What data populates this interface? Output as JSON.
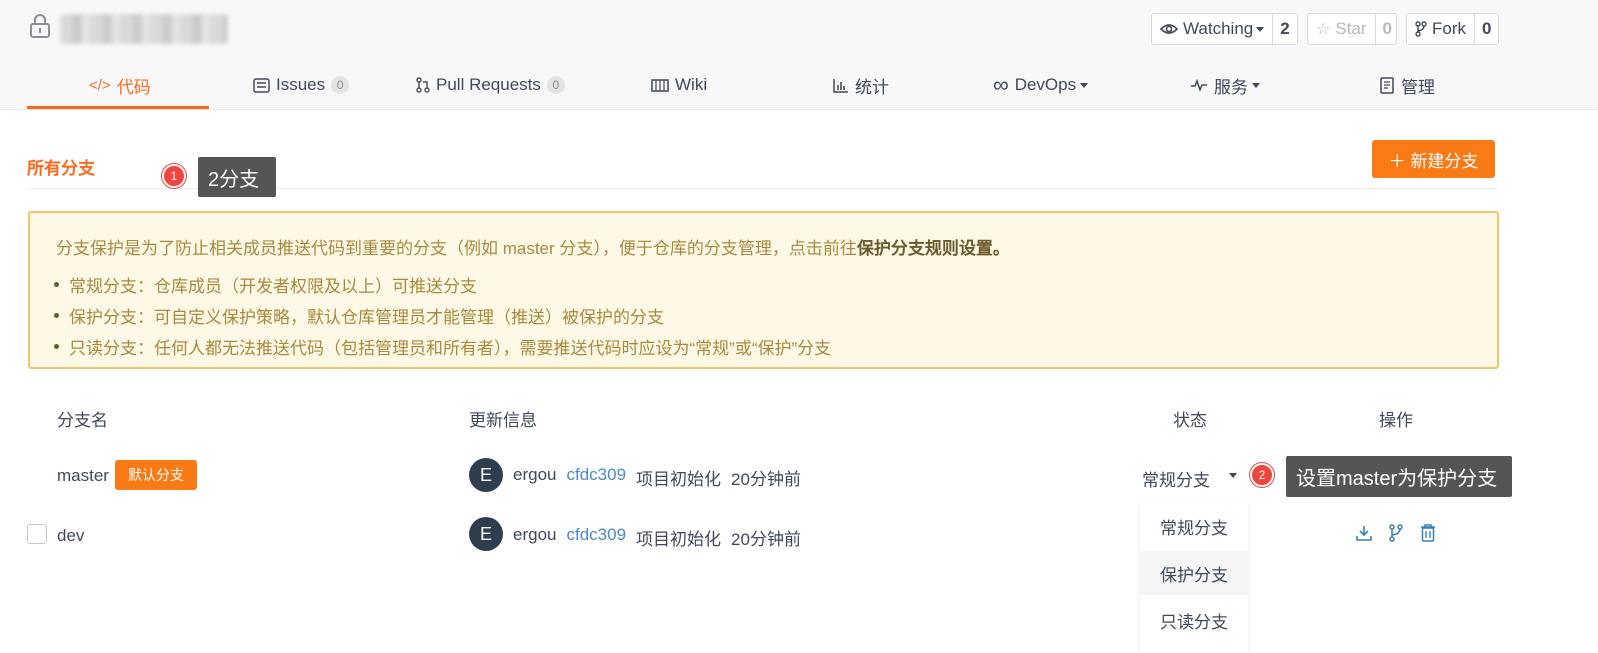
{
  "header": {
    "watch": {
      "label": "Watching",
      "count": "2",
      "icon": "eye-icon"
    },
    "star": {
      "label": "Star",
      "count": "0",
      "icon": "star-icon"
    },
    "fork": {
      "label": "Fork",
      "count": "0",
      "icon": "fork-icon"
    }
  },
  "nav": {
    "items": [
      {
        "label": "代码",
        "icon": "code-icon",
        "active": true
      },
      {
        "label": "Issues",
        "icon": "issues-icon",
        "badge": "0"
      },
      {
        "label": "Pull Requests",
        "icon": "pull-request-icon",
        "badge": "0"
      },
      {
        "label": "Wiki",
        "icon": "wiki-icon"
      },
      {
        "label": "统计",
        "icon": "chart-icon"
      },
      {
        "label": "DevOps",
        "icon": "infinity-icon"
      },
      {
        "label": "服务",
        "icon": "pulse-icon"
      },
      {
        "label": "管理",
        "icon": "manage-icon"
      }
    ]
  },
  "section": {
    "title": "所有分支",
    "new_branch": "＋ 新建分支"
  },
  "markers": [
    {
      "num": "1",
      "tooltip": "2分支"
    },
    {
      "num": "2",
      "tooltip": "设置master为保护分支"
    }
  ],
  "notice": {
    "head_text": "分支保护是为了防止相关成员推送代码到重要的分支（例如 master 分支），便于仓库的分支管理，点击前往",
    "head_link": "保护分支规则设置。",
    "items": [
      "常规分支：仓库成员（开发者权限及以上）可推送分支",
      "保护分支：可自定义保护策略，默认仓库管理员才能管理（推送）被保护的分支",
      "只读分支：任何人都无法推送代码（包括管理员和所有者），需要推送代码时应设为“常规”或“保护”分支"
    ]
  },
  "table": {
    "headers": {
      "name": "分支名",
      "update": "更新信息",
      "status": "状态",
      "actions": "操作"
    },
    "rows": [
      {
        "name": "master",
        "tag": "默认分支",
        "avatar": "E",
        "author": "ergou",
        "hash": "cfdc309",
        "message": "项目初始化",
        "time": "20分钟前",
        "status": "常规分支"
      },
      {
        "name": "dev",
        "avatar": "E",
        "author": "ergou",
        "hash": "cfdc309",
        "message": "项目初始化",
        "time": "20分钟前"
      }
    ]
  },
  "status_menu": {
    "options": [
      "常规分支",
      "保护分支",
      "只读分支"
    ]
  },
  "colors": {
    "accent": "#fa6a1e",
    "marker": "#f0443f",
    "link": "#4a8bc2"
  }
}
